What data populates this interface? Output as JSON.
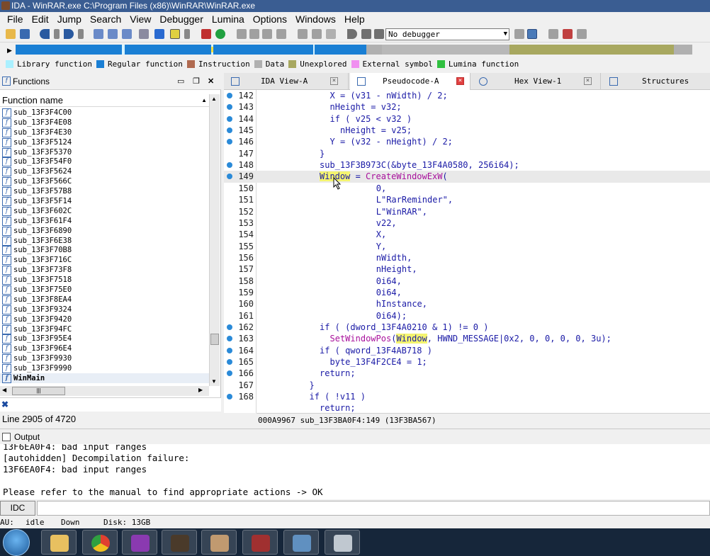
{
  "window": {
    "title": "IDA - WinRAR.exe C:\\Program Files (x86)\\WinRAR\\WinRAR.exe"
  },
  "menu": [
    "File",
    "Edit",
    "Jump",
    "Search",
    "View",
    "Debugger",
    "Lumina",
    "Options",
    "Windows",
    "Help"
  ],
  "toolbar": {
    "debugger_select": "No debugger"
  },
  "legend": [
    {
      "label": "Library function",
      "color": "#aaf0ff"
    },
    {
      "label": "Regular function",
      "color": "#1a7fd4"
    },
    {
      "label": "Instruction",
      "color": "#b06a50"
    },
    {
      "label": "Data",
      "color": "#b0b0b0"
    },
    {
      "label": "Unexplored",
      "color": "#a8a860"
    },
    {
      "label": "External symbol",
      "color": "#f090f0"
    },
    {
      "label": "Lumina function",
      "color": "#30c040"
    }
  ],
  "functions_panel": {
    "title": "Functions",
    "column_header": "Function name",
    "items": [
      "sub_13F3F4C00",
      "sub_13F3F4E08",
      "sub_13F3F4E30",
      "sub_13F3F5124",
      "sub_13F3F5370",
      "sub_13F3F54F0",
      "sub_13F3F5624",
      "sub_13F3F566C",
      "sub_13F3F57B8",
      "sub_13F3F5F14",
      "sub_13F3F602C",
      "sub_13F3F61F4",
      "sub_13F3F6890",
      "sub_13F3F6E38",
      "sub_13F3F70B8",
      "sub_13F3F716C",
      "sub_13F3F73F8",
      "sub_13F3F7518",
      "sub_13F3F75E0",
      "sub_13F3F8EA4",
      "sub_13F3F9324",
      "sub_13F3F9420",
      "sub_13F3F94FC",
      "sub_13F3F95E4",
      "sub_13F3F96E4",
      "sub_13F3F9930",
      "sub_13F3F9990",
      "WinMain"
    ],
    "selected": "WinMain",
    "line_status": "Line 2905 of 4720"
  },
  "tabs": [
    {
      "label": "IDA View-A"
    },
    {
      "label": "Pseudocode-A"
    },
    {
      "label": "Hex View-1"
    },
    {
      "label": "Structures"
    }
  ],
  "code_lines": [
    {
      "n": "142",
      "dot": true,
      "text": "X = (v31 - nWidth) / 2;",
      "indent": 14
    },
    {
      "n": "143",
      "dot": true,
      "text": "nHeight = v32;",
      "indent": 14
    },
    {
      "n": "144",
      "dot": true,
      "text": "if ( v25 < v32 )",
      "indent": 14
    },
    {
      "n": "145",
      "dot": true,
      "text": "nHeight = v25;",
      "indent": 16
    },
    {
      "n": "146",
      "dot": true,
      "text": "Y = (v32 - nHeight) / 2;",
      "indent": 14
    },
    {
      "n": "147",
      "dot": false,
      "text": "}",
      "indent": 12
    },
    {
      "n": "148",
      "dot": true,
      "text": "sub_13F3B973C(&byte_13F4A0580, 256i64);",
      "indent": 12
    },
    {
      "n": "149",
      "dot": true,
      "text": "Window = CreateWindowExW(",
      "indent": 12
    },
    {
      "n": "150",
      "dot": false,
      "text": "0,",
      "indent": 23
    },
    {
      "n": "151",
      "dot": false,
      "text": "L\"RarReminder\",",
      "indent": 23
    },
    {
      "n": "152",
      "dot": false,
      "text": "L\"WinRAR\",",
      "indent": 23
    },
    {
      "n": "153",
      "dot": false,
      "text": "v22,",
      "indent": 23
    },
    {
      "n": "154",
      "dot": false,
      "text": "X,",
      "indent": 23
    },
    {
      "n": "155",
      "dot": false,
      "text": "Y,",
      "indent": 23
    },
    {
      "n": "156",
      "dot": false,
      "text": "nWidth,",
      "indent": 23
    },
    {
      "n": "157",
      "dot": false,
      "text": "nHeight,",
      "indent": 23
    },
    {
      "n": "158",
      "dot": false,
      "text": "0i64,",
      "indent": 23
    },
    {
      "n": "159",
      "dot": false,
      "text": "0i64,",
      "indent": 23
    },
    {
      "n": "160",
      "dot": false,
      "text": "hInstance,",
      "indent": 23
    },
    {
      "n": "161",
      "dot": false,
      "text": "0i64);",
      "indent": 23
    },
    {
      "n": "162",
      "dot": true,
      "text": "if ( (dword_13F4A0210 & 1) != 0 )",
      "indent": 12
    },
    {
      "n": "163",
      "dot": true,
      "text": "SetWindowPos(Window, HWND_MESSAGE|0x2, 0, 0, 0, 0, 3u);",
      "indent": 14
    },
    {
      "n": "164",
      "dot": true,
      "text": "if ( qword_13F4AB718 )",
      "indent": 12
    },
    {
      "n": "165",
      "dot": true,
      "text": "byte_13F4F2CE4 = 1;",
      "indent": 14
    },
    {
      "n": "166",
      "dot": true,
      "text": "return;",
      "indent": 12
    },
    {
      "n": "167",
      "dot": false,
      "text": "}",
      "indent": 10
    },
    {
      "n": "168",
      "dot": true,
      "text": "if ( !v11 )",
      "indent": 10
    },
    {
      "n": "",
      "dot": false,
      "text": "return;",
      "indent": 12
    }
  ],
  "code_status": "000A9967 sub_13F3BA0F4:149 (13F3BA567)",
  "output": {
    "title": "Output",
    "lines": [
      "13F6EA0F4: bad input ranges",
      "[autohidden] Decompilation failure:",
      "13F6EA0F4: bad input ranges",
      "",
      "Please refer to the manual to find appropriate actions -> OK"
    ]
  },
  "idc_button": "IDC",
  "statusbar": {
    "au": "AU:",
    "state": "idle",
    "direction": "Down",
    "disk": "Disk: 13GB"
  }
}
